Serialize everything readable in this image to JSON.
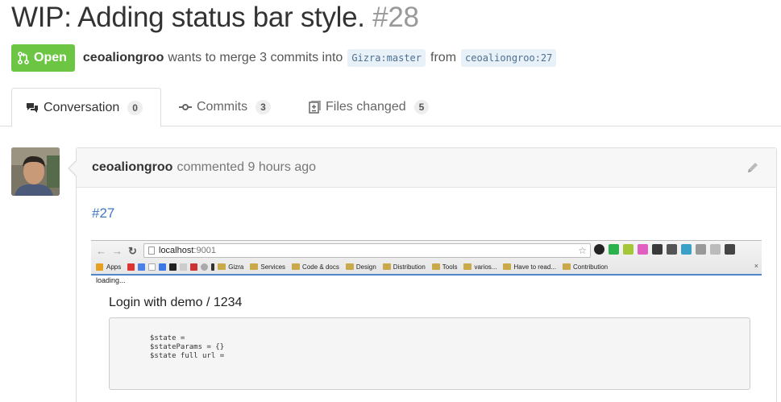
{
  "pr": {
    "title": "WIP: Adding status bar style.",
    "number": "#28",
    "state": "Open",
    "author": "ceoaliongroo",
    "merge_text_1": "wants to merge 3 commits into",
    "base_ref": "Gizra:master",
    "merge_text_2": "from",
    "head_ref": "ceoaliongroo:27"
  },
  "tabs": [
    {
      "label": "Conversation",
      "count": "0",
      "icon": "conversation-icon"
    },
    {
      "label": "Commits",
      "count": "3",
      "icon": "commit-icon"
    },
    {
      "label": "Files changed",
      "count": "5",
      "icon": "diff-icon"
    }
  ],
  "comment": {
    "author": "ceoaliongroo",
    "action": "commented",
    "time": "9 hours ago",
    "link": "#27"
  },
  "screenshot": {
    "url_host": "localhost",
    "url_port": ":9001",
    "bookmarks": [
      "Apps",
      "Gizra",
      "Services",
      "Code & docs",
      "Design",
      "Distribution",
      "Tools",
      "varios...",
      "Have to read...",
      "Contribution"
    ],
    "loading": "loading...",
    "login_title": "Login with demo / 1234",
    "code_lines": [
      "$state =",
      "$stateParams = {}",
      "$state full url ="
    ]
  },
  "colors": {
    "open_green": "#6cc644",
    "link_blue": "#4078c0",
    "ref_bg": "#e8f1f8"
  }
}
